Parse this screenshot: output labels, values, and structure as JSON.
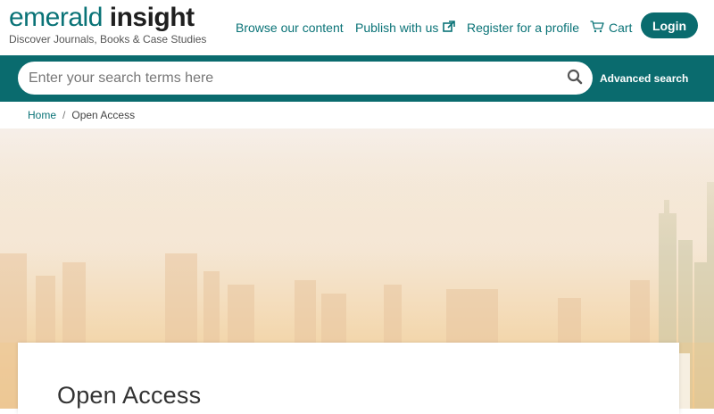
{
  "brand": {
    "name_part1": "emerald",
    "name_part2": "insight",
    "tagline": "Discover Journals, Books & Case Studies",
    "color": "#0a7377"
  },
  "nav": {
    "browse": "Browse our content",
    "publish": "Publish with us",
    "register": "Register for a profile",
    "cart": "Cart",
    "login": "Login"
  },
  "search": {
    "placeholder": "Enter your search terms here",
    "value": "",
    "advanced": "Advanced search"
  },
  "breadcrumb": {
    "home": "Home",
    "separator": "/",
    "current": "Open Access"
  },
  "page": {
    "title": "Open Access"
  },
  "icons": {
    "publish_external": "external-link-icon",
    "cart": "cart-icon",
    "search": "search-icon"
  },
  "colors": {
    "teal_bar": "#0a6b6e",
    "link": "#0a7377"
  }
}
